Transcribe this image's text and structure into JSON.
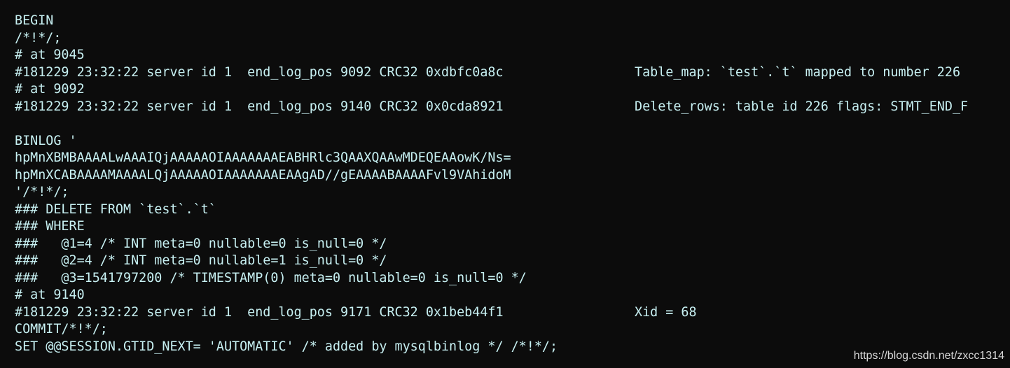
{
  "terminal": {
    "lines": [
      {
        "left": "BEGIN",
        "right": ""
      },
      {
        "left": "/*!*/;",
        "right": ""
      },
      {
        "left": "# at 9045",
        "right": ""
      },
      {
        "left": "#181229 23:32:22 server id 1  end_log_pos 9092 CRC32 0xdbfc0a8c",
        "right": "Table_map: `test`.`t` mapped to number 226"
      },
      {
        "left": "# at 9092",
        "right": ""
      },
      {
        "left": "#181229 23:32:22 server id 1  end_log_pos 9140 CRC32 0x0cda8921",
        "right": "Delete_rows: table id 226 flags: STMT_END_F"
      },
      {
        "left": "",
        "right": ""
      },
      {
        "left": "BINLOG '",
        "right": ""
      },
      {
        "left": "hpMnXBMBAAAALwAAAIQjAAAAAOIAAAAAAAEABHRlc3QAAXQAAwMDEQEAAowK/Ns=",
        "right": ""
      },
      {
        "left": "hpMnXCABAAAAMAAAALQjAAAAAOIAAAAAAAEAAgAD//gEAAAABAAAAFvl9VAhidoM",
        "right": ""
      },
      {
        "left": "'/*!*/;",
        "right": ""
      },
      {
        "left": "### DELETE FROM `test`.`t`",
        "right": ""
      },
      {
        "left": "### WHERE",
        "right": ""
      },
      {
        "left": "###   @1=4 /* INT meta=0 nullable=0 is_null=0 */",
        "right": ""
      },
      {
        "left": "###   @2=4 /* INT meta=0 nullable=1 is_null=0 */",
        "right": ""
      },
      {
        "left": "###   @3=1541797200 /* TIMESTAMP(0) meta=0 nullable=0 is_null=0 */",
        "right": ""
      },
      {
        "left": "# at 9140",
        "right": ""
      },
      {
        "left": "#181229 23:32:22 server id 1  end_log_pos 9171 CRC32 0x1beb44f1",
        "right": "Xid = 68"
      },
      {
        "left": "COMMIT/*!*/;",
        "right": ""
      },
      {
        "left": "SET @@SESSION.GTID_NEXT= 'AUTOMATIC' /* added by mysqlbinlog */ /*!*/;",
        "right": ""
      }
    ]
  },
  "watermark": {
    "text": "https://blog.csdn.net/zxcc1314"
  },
  "colors": {
    "background": "#0c0c0c",
    "text": "#c7f0f2",
    "watermark": "#d8d8d8"
  }
}
